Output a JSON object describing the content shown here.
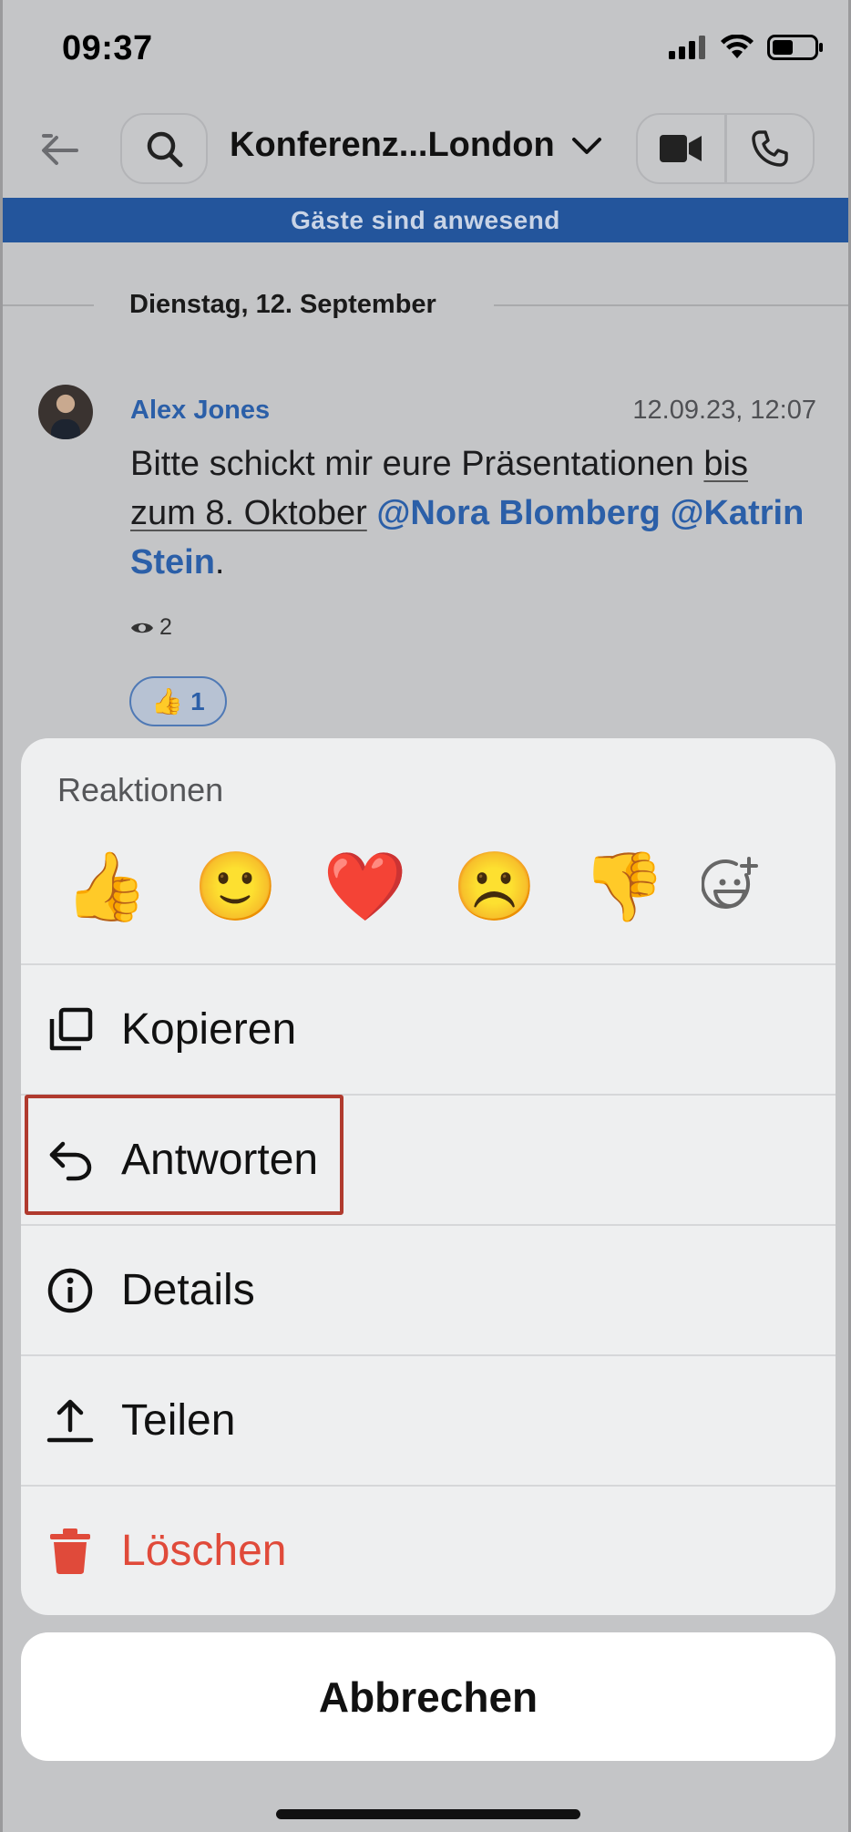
{
  "status_bar": {
    "time": "09:37"
  },
  "nav": {
    "title": "Konferenz...London"
  },
  "banner": {
    "text": "Gäste sind anwesend"
  },
  "chat": {
    "date_separator": "Dienstag, 12. September",
    "message": {
      "sender": "Alex Jones",
      "timestamp": "12.09.23, 12:07",
      "text_part1": "Bitte schickt mir eure Präsentationen ",
      "text_underlined": "bis zum 8. Oktober",
      "text_part2": " ",
      "mention1": "@Nora Blomberg",
      "text_part3": " ",
      "mention2": "@Katrin Stein",
      "text_end": ".",
      "seen_count": "2",
      "reaction": {
        "emoji": "👍",
        "count": "1"
      }
    }
  },
  "sheet": {
    "title": "Reaktionen",
    "emojis": [
      "👍",
      "🙂",
      "❤️",
      "☹️",
      "👎"
    ],
    "actions": {
      "copy": "Kopieren",
      "reply": "Antworten",
      "details": "Details",
      "share": "Teilen",
      "delete": "Löschen"
    },
    "cancel": "Abbrechen"
  },
  "colors": {
    "accent": "#2b5fa8",
    "banner": "#23559c",
    "danger": "#e04a3a",
    "highlight": "#b03a2e"
  },
  "icons": {
    "back": "back-arrow-icon",
    "search": "search-icon",
    "dropdown": "chevron-down-icon",
    "video": "video-camera-icon",
    "phone": "phone-icon",
    "add_reaction": "add-emoji-icon",
    "copy": "copy-icon",
    "reply": "reply-icon",
    "details": "info-icon",
    "share": "share-icon",
    "delete": "trash-icon"
  }
}
